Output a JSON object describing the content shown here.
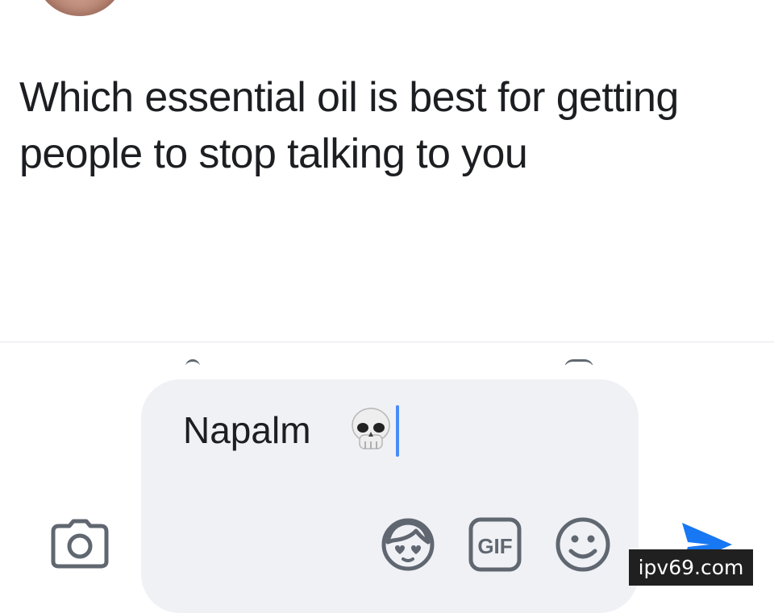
{
  "post": {
    "text": "Which essential oil is best for getting people to stop talking to you"
  },
  "composer": {
    "input_value": "Napalm",
    "emoji": "skull",
    "caret_color": "#4a8cf7",
    "bubble_color": "#eff1f5",
    "icons": {
      "camera": "camera-icon",
      "avatar_sticker": "avatar-sticker-icon",
      "gif_label": "GIF",
      "emoji": "smiley-icon",
      "send": "send-icon"
    },
    "send_color": "#1877f2"
  },
  "watermark": {
    "text": "ipv69.com"
  }
}
